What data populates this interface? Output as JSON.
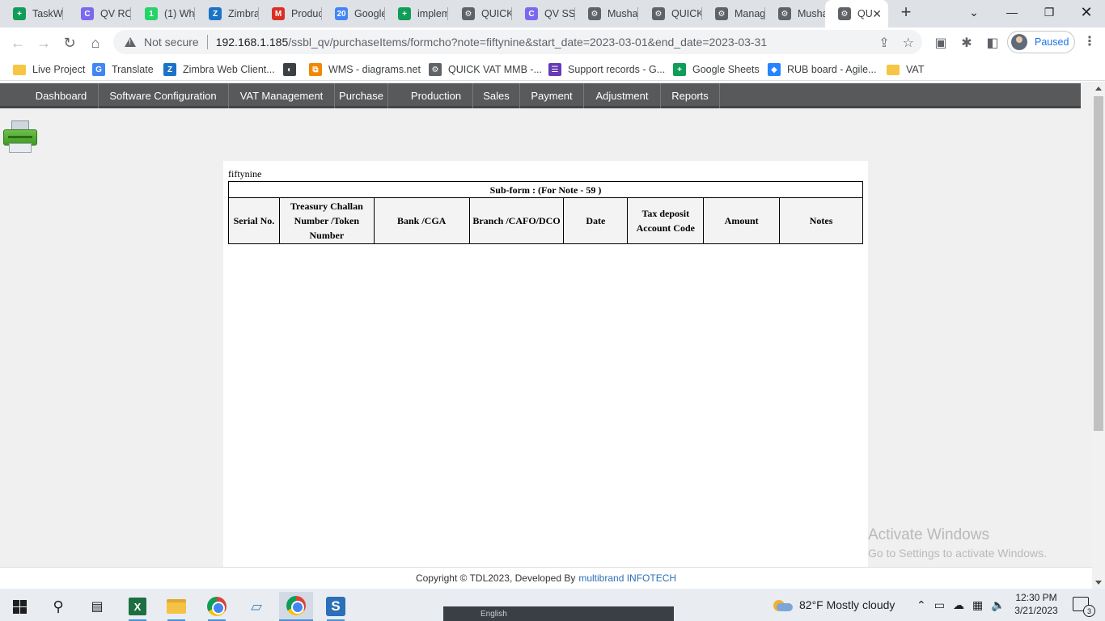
{
  "browser": {
    "tabs": [
      {
        "title": "TaskWi",
        "icon": "google-sheets-icon",
        "color": "#0f9d58",
        "glyph": "+"
      },
      {
        "title": "QV RO",
        "icon": "clickup-icon",
        "color": "#7b68ee",
        "glyph": "C"
      },
      {
        "title": "(1) Wh",
        "icon": "whatsapp-badge-icon",
        "color": "#25d366",
        "glyph": "1"
      },
      {
        "title": "Zimbra",
        "icon": "zimbra-icon",
        "color": "#1a73c8",
        "glyph": "Z"
      },
      {
        "title": "Produc",
        "icon": "gmail-icon",
        "color": "#d93025",
        "glyph": "M"
      },
      {
        "title": "Google",
        "icon": "google-calendar-icon",
        "color": "#4285f4",
        "glyph": "20"
      },
      {
        "title": "implem",
        "icon": "google-sheets-icon",
        "color": "#0f9d58",
        "glyph": "+"
      },
      {
        "title": "QUICK",
        "icon": "gear-icon",
        "color": "#5f6368",
        "glyph": "⚙"
      },
      {
        "title": "QV SSE",
        "icon": "clickup-icon",
        "color": "#7b68ee",
        "glyph": "C"
      },
      {
        "title": "Mushal",
        "icon": "gear-icon",
        "color": "#5f6368",
        "glyph": "⚙"
      },
      {
        "title": "QUICK",
        "icon": "gear-icon",
        "color": "#5f6368",
        "glyph": "⚙"
      },
      {
        "title": "Manag",
        "icon": "gear-icon",
        "color": "#5f6368",
        "glyph": "⚙"
      },
      {
        "title": "Musha",
        "icon": "gear-icon",
        "color": "#5f6368",
        "glyph": "⚙"
      },
      {
        "title": "QU",
        "icon": "gear-icon",
        "color": "#5f6368",
        "glyph": "⚙",
        "active": true
      }
    ],
    "security_label": "Not secure",
    "url_host": "192.168.1.185",
    "url_path": "/ssbl_qv/purchaseItems/formcho?note=fiftynine&start_date=2023-03-01&end_date=2023-03-31",
    "profile_status": "Paused",
    "bookmarks": [
      {
        "label": "Live Project",
        "icon": "folder-icon",
        "color": "#f6c544"
      },
      {
        "label": "Translate",
        "icon": "google-translate-icon",
        "color": "#4285f4",
        "glyph": "G"
      },
      {
        "label": "Zimbra Web Client...",
        "icon": "zimbra-icon",
        "color": "#1a73c8",
        "glyph": "Z"
      },
      {
        "label": "",
        "icon": "globe-icon",
        "color": "#3c4043",
        "glyph": "◐"
      },
      {
        "label": "WMS - diagrams.net",
        "icon": "diagrams-icon",
        "color": "#f08705",
        "glyph": "⧉"
      },
      {
        "label": "QUICK VAT MMB -...",
        "icon": "gear-icon",
        "color": "#5f6368",
        "glyph": "⚙"
      },
      {
        "label": "Support records - G...",
        "icon": "google-forms-icon",
        "color": "#673ab7",
        "glyph": "☰"
      },
      {
        "label": "Google Sheets",
        "icon": "google-sheets-icon",
        "color": "#0f9d58",
        "glyph": "+"
      },
      {
        "label": "RUB board - Agile...",
        "icon": "jira-icon",
        "color": "#2684ff",
        "glyph": "◆"
      },
      {
        "label": "VAT",
        "icon": "folder-icon",
        "color": "#f6c544"
      }
    ]
  },
  "app_nav": [
    "Dashboard",
    "Software Configuration",
    "VAT Management",
    "Purchase",
    "Production",
    "Sales",
    "Payment",
    "Adjustment",
    "Reports"
  ],
  "form": {
    "name": "fiftynine",
    "caption": "Sub-form : (For Note - 59 )",
    "columns": [
      "Serial No.",
      "Treasury Challan Number /Token Number",
      "Bank /CGA",
      "Branch /CAFO/DCO",
      "Date",
      "Tax deposit Account Code",
      "Amount",
      "Notes"
    ]
  },
  "footer": {
    "text": "Copyright © TDL2023, Developed By",
    "link": "multibrand INFOTECH"
  },
  "watermark": {
    "line1": "Activate Windows",
    "line2": "Go to Settings to activate Windows."
  },
  "taskbar": {
    "mini_preview_label": "English",
    "weather": "82°F  Mostly cloudy",
    "time": "12:30 PM",
    "date": "3/21/2023",
    "notification_count": "3"
  }
}
